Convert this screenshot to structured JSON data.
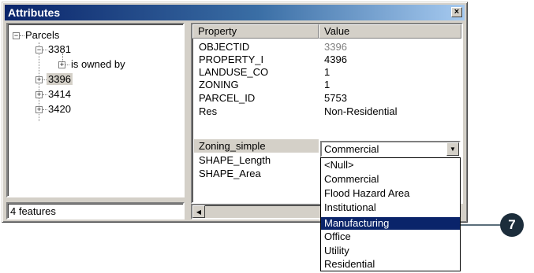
{
  "window": {
    "title": "Attributes",
    "close_glyph": "×"
  },
  "tree": {
    "root": "Parcels",
    "nodes": [
      {
        "label": "3381",
        "children": [
          {
            "label": "is owned by"
          }
        ]
      },
      {
        "label": "3396",
        "selected": true
      },
      {
        "label": "3414"
      },
      {
        "label": "3420"
      }
    ]
  },
  "status": {
    "text": "4 features"
  },
  "grid": {
    "headers": {
      "property": "Property",
      "value": "Value"
    },
    "rows": [
      {
        "property": "OBJECTID",
        "value": "3396"
      },
      {
        "property": "PROPERTY_I",
        "value": "4396"
      },
      {
        "property": "LANDUSE_CO",
        "value": "1"
      },
      {
        "property": "ZONING",
        "value": "1"
      },
      {
        "property": "PARCEL_ID",
        "value": "5753"
      },
      {
        "property": "Res",
        "value": "Non-Residential"
      },
      {
        "property": "Zoning_simple",
        "value": "Commercial"
      },
      {
        "property": "SHAPE_Length",
        "value": ""
      },
      {
        "property": "SHAPE_Area",
        "value": ""
      }
    ]
  },
  "combo": {
    "value": "Commercial"
  },
  "dropdown": {
    "options": [
      "<Null>",
      "Commercial",
      "Flood Hazard Area",
      "Institutional",
      "Manufacturing",
      "Office",
      "Utility",
      "Residential"
    ],
    "selected": "Manufacturing"
  },
  "callout": {
    "number": "7"
  },
  "icons": {
    "close": "close-icon",
    "expand": "plus-box-icon",
    "collapse": "minus-box-icon",
    "dropdown": "chevron-down-icon",
    "scroll_left": "arrow-left-icon"
  },
  "colors": {
    "selection": "#0a246a",
    "titlebar": "#0a246a",
    "callout": "#1c2d3b"
  }
}
